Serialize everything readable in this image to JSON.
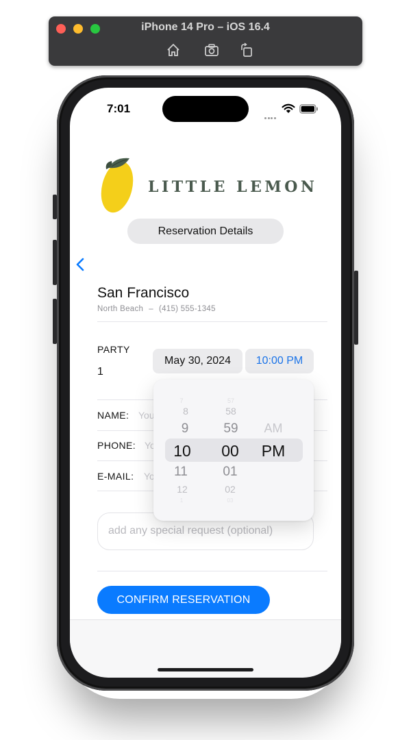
{
  "simulator": {
    "title": "iPhone 14 Pro – iOS 16.4",
    "toolbar_icons": [
      "home-icon",
      "screenshot-icon",
      "rotate-icon"
    ]
  },
  "status_bar": {
    "time": "7:01"
  },
  "header": {
    "logo_text": "LITTLE LEMON",
    "section_title": "Reservation Details"
  },
  "restaurant": {
    "city": "San Francisco",
    "neighborhood": "North Beach",
    "separator": "–",
    "phone": "(415) 555-1345"
  },
  "party": {
    "label": "PARTY",
    "value": "1"
  },
  "date_button": "May 30, 2024",
  "time_button": "10:00 PM",
  "time_picker": {
    "hours": [
      "7",
      "8",
      "9",
      "10",
      "11",
      "12",
      "1"
    ],
    "minutes": [
      "57",
      "58",
      "59",
      "00",
      "01",
      "02",
      "03"
    ],
    "periods": [
      "AM",
      "PM"
    ],
    "selected": {
      "hour": "10",
      "minute": "00",
      "period": "PM"
    }
  },
  "form": {
    "name_label": "NAME:",
    "name_placeholder": "Your name...",
    "phone_label": "PHONE:",
    "phone_placeholder": "Your phone number...",
    "email_label": "E-MAIL:",
    "email_placeholder": "Your e-mail...",
    "special_placeholder": "add any special request (optional)"
  },
  "confirm_label": "CONFIRM RESERVATION",
  "colors": {
    "accent": "#0a7bff",
    "logo_green": "#4a5a4e",
    "lemon_yellow": "#f4cf1a",
    "leaf_green": "#495e4c"
  }
}
